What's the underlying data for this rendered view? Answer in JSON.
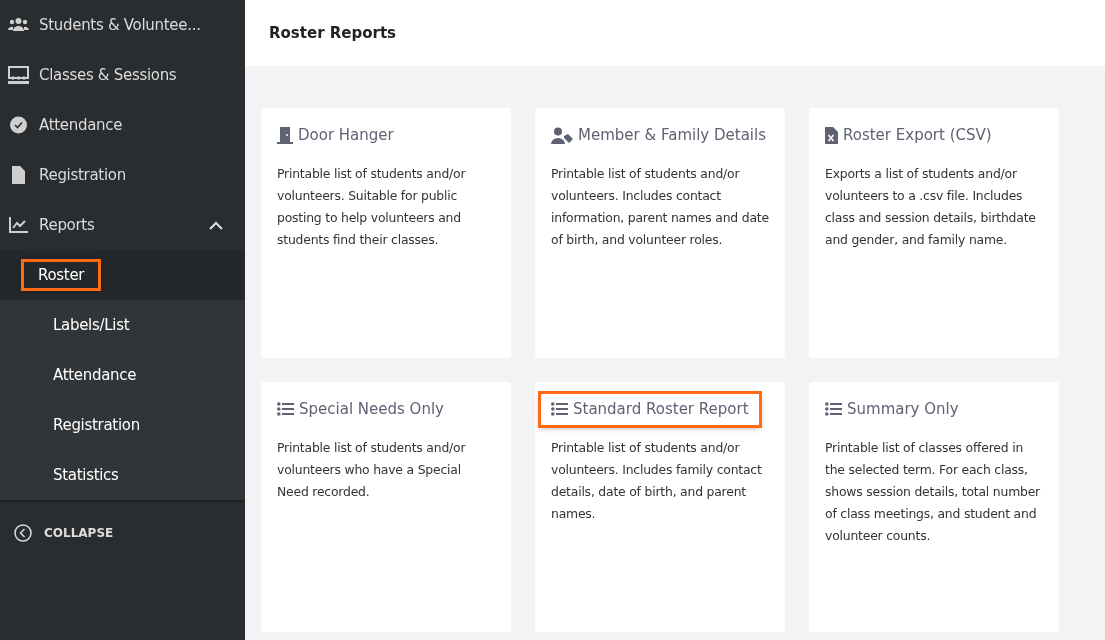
{
  "sidebar": {
    "items": [
      {
        "label": "Students & Voluntee...",
        "kind": "people"
      },
      {
        "label": "Classes & Sessions",
        "kind": "classroom"
      },
      {
        "label": "Attendance",
        "kind": "check"
      },
      {
        "label": "Registration",
        "kind": "file"
      },
      {
        "label": "Reports",
        "kind": "chart",
        "expanded": true,
        "children": [
          {
            "label": "Roster",
            "selected": true,
            "highlighted": true
          },
          {
            "label": "Labels/List",
            "selected": false,
            "highlighted": false
          },
          {
            "label": "Attendance",
            "selected": false,
            "highlighted": false
          },
          {
            "label": "Registration",
            "selected": false,
            "highlighted": false
          },
          {
            "label": "Statistics",
            "selected": false,
            "highlighted": false
          }
        ]
      }
    ],
    "collapse": "COLLAPSE"
  },
  "page_title": "Roster Reports",
  "cards": [
    {
      "kind": "door",
      "title": "Door Hanger",
      "highlighted": false,
      "description": "Printable list of students and/or volunteers. Suitable for public posting to help volunteers and students find their classes."
    },
    {
      "kind": "member",
      "title": "Member & Family Details",
      "highlighted": false,
      "description": "Printable list of students and/or volunteers. Includes contact information, parent names and date of birth, and volunteer roles."
    },
    {
      "kind": "export",
      "title": "Roster Export (CSV)",
      "highlighted": false,
      "description": "Exports a list of students and/or volunteers to a .csv file. Includes class and session details, birthdate and gender, and family name."
    },
    {
      "kind": "list",
      "title": "Special Needs Only",
      "highlighted": false,
      "description": "Printable list of students and/or volunteers who have a Special Need recorded."
    },
    {
      "kind": "list",
      "title": "Standard Roster Report",
      "highlighted": true,
      "description": "Printable list of students and/or volunteers. Includes family contact details, date of birth, and parent names."
    },
    {
      "kind": "list",
      "title": "Summary Only",
      "highlighted": false,
      "description": "Printable list of classes offered in the selected term. For each class, shows session details, total number of class meetings, and student and volunteer counts."
    }
  ]
}
